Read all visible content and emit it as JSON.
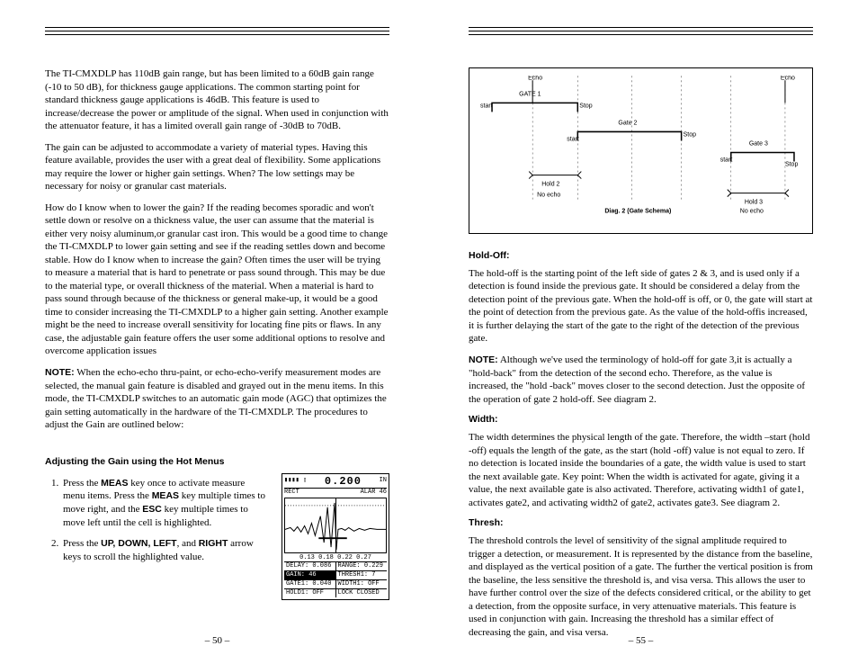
{
  "left": {
    "p1": "The TI-CMXDLP has 110dB gain range, but has been limited to a 60dB gain range (-10 to 50 dB), for thickness gauge applications. The common starting point for standard thickness gauge applications is 46dB. This feature is used to increase/decrease the power or amplitude of the signal. When used in conjunction with the attenuator feature, it has a limited overall gain range of -30dB to 70dB.",
    "p2": "The gain can be adjusted to accommodate a variety of material types. Having this feature available, provides the user with a great deal of flexibility. Some applications may require the lower or higher gain settings. When? The low settings may be necessary for noisy or granular cast materials.",
    "p3": "How do I know when to lower the gain? If the reading becomes sporadic and won't settle down or resolve on a thickness value, the user can assume that the material is either very noisy aluminum,or granular cast iron. This would be a good time to change the TI-CMXDLP to lower gain setting and see if the reading settles down and become stable. How do I know when to increase the gain? Often times the user will be trying to measure a material that is hard to penetrate or pass sound through. This may be due to the material type, or overall thickness of the material. When a material is hard to pass sound through because of the thickness or general make-up, it would be a good time to consider increasing the TI-CMXDLP to a higher gain setting. Another example might be the need to increase overall sensitivity for locating fine pits or flaws. In any case, the adjustable gain feature offers the user some additional options to resolve and overcome application issues",
    "note_label": "NOTE:",
    "note_text": " When the echo-echo thru-paint, or echo-echo-verify measurement modes are selected, the manual gain feature is disabled and grayed out in the menu items. In this mode, the TI-CMXDLP switches to an automatic gain mode (AGC) that optimizes the gain setting automatically in the hardware of the TI-CMXDLP. The procedures to adjust the Gain are outlined below:",
    "subhead": "Adjusting the Gain using the Hot Menus",
    "step1a": "Press the ",
    "step1_meas": "MEAS",
    "step1b": " key once to activate measure menu items. Press the ",
    "step1c": " key multiple times to move right, and the ",
    "step1_esc": "ESC",
    "step1d": " key multiple times to move left until the cell is highlighted.",
    "step2a": "Press the ",
    "step2_keys": "UP, DOWN, LEFT",
    "step2_and": ", and ",
    "step2_right": "RIGHT",
    "step2b": " arrow keys to scroll the highlighted value.",
    "lcd": {
      "reading": "0.200",
      "unit": "IN",
      "mode": "RECT",
      "alarm": "ALAR  46",
      "scale": "0.13  0.18  0.22  0.27",
      "r1a": "DELAY: 0.086",
      "r1b": "RANGE: 0.229",
      "r2a": "GAIN:      46",
      "r2b": "THRESH1:    7",
      "r3a": "GATE1: 0.040",
      "r3b": "WIDTH1:   OFF",
      "r4a": "HOLD1:    OFF",
      "r4b": "LOCK  CLOSED"
    },
    "pagenum": "– 50 –"
  },
  "right": {
    "diag": {
      "echo": "Echo",
      "gate1": "GATE 1",
      "gate2": "Gate 2",
      "gate3": "Gate 3",
      "start": "start",
      "stop": "Stop",
      "hold2": "Hold 2",
      "hold3": "Hold 3",
      "noecho": "No echo",
      "title": "Diag. 2 (Gate Schema)"
    },
    "h_holdoff": "Hold-Off:",
    "p_holdoff": "The hold-off is the starting point of the left side of gates 2 & 3, and is used only if a detection is found inside the previous gate. It should be considered a delay from the detection point of the previous gate. When the hold-off is off, or 0, the gate will start at the point of detection from the previous gate. As the value of the hold-offis increased, it is further delaying the start of the gate to the right of the detection of the previous gate.",
    "note_label": "NOTE:",
    "note_text": " Although we've used the terminology of hold-off for gate 3,it is actually a \"hold-back\" from the detection of the second echo. Therefore, as the value is increased, the \"hold -back\" moves closer to the second detection. Just the opposite of the operation of gate 2 hold-off. See diagram 2.",
    "h_width": "Width:",
    "p_width": "The width determines the physical length of the gate. Therefore, the width –start (hold -off) equals the length of the gate, as the start (hold -off) value is not equal to zero. If no detection is located inside the boundaries of a gate, the width value is used to start the next available gate. Key point: When the width is activated for agate, giving it a value, the next available gate is also activated. Therefore, activating width1 of gate1, activates gate2, and activating width2 of gate2, activates gate3. See diagram 2.",
    "h_thresh": "Thresh:",
    "p_thresh": "The threshold controls the level of sensitivity of the signal amplitude required to trigger a detection, or measurement. It is represented by the distance from the baseline, and displayed as the vertical position of a gate. The further the vertical position is from the baseline, the less sensitive the threshold is, and visa versa. This allows the user to have further control over the size of the defects considered critical, or the ability to get a detection, from the opposite surface, in very attenuative materials. This feature is used in conjunction with gain. Increasing the threshold has a similar effect of decreasing the gain, and visa versa.",
    "pagenum": "– 55 –"
  }
}
